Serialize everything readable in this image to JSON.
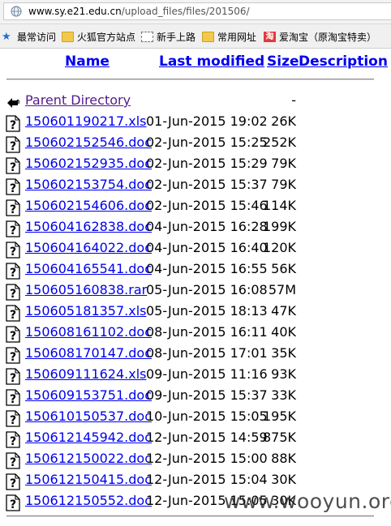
{
  "browser": {
    "url_host": "www.sy.e21.edu.cn",
    "url_path": "/upload_files/files/201506/"
  },
  "bookmarks": [
    {
      "label": "最常访问",
      "icon": "star-icon"
    },
    {
      "label": "火狐官方站点",
      "icon": "folder-icon"
    },
    {
      "label": "新手上路",
      "icon": "page-icon"
    },
    {
      "label": "常用网址",
      "icon": "folder-icon"
    },
    {
      "label": "爱淘宝（原淘宝特卖）",
      "icon": "taobao-icon"
    }
  ],
  "listing": {
    "headers": {
      "name": "Name",
      "modified": "Last modified",
      "size": "Size",
      "description": "Description"
    },
    "parent": {
      "label": "Parent Directory",
      "size": "-"
    },
    "files": [
      {
        "name": "150601190217.xls",
        "modified": "01-Jun-2015 19:02",
        "size": "26K"
      },
      {
        "name": "150602152546.doc",
        "modified": "02-Jun-2015 15:25",
        "size": "252K"
      },
      {
        "name": "150602152935.doc",
        "modified": "02-Jun-2015 15:29",
        "size": "79K"
      },
      {
        "name": "150602153754.doc",
        "modified": "02-Jun-2015 15:37",
        "size": "79K"
      },
      {
        "name": "150602154606.doc",
        "modified": "02-Jun-2015 15:46",
        "size": "114K"
      },
      {
        "name": "150604162838.doc",
        "modified": "04-Jun-2015 16:28",
        "size": "199K"
      },
      {
        "name": "150604164022.doc",
        "modified": "04-Jun-2015 16:40",
        "size": "120K"
      },
      {
        "name": "150604165541.doc",
        "modified": "04-Jun-2015 16:55",
        "size": "56K"
      },
      {
        "name": "150605160838.rar",
        "modified": "05-Jun-2015 16:08",
        "size": "57M"
      },
      {
        "name": "150605181357.xls",
        "modified": "05-Jun-2015 18:13",
        "size": "47K"
      },
      {
        "name": "150608161102.doc",
        "modified": "08-Jun-2015 16:11",
        "size": "40K"
      },
      {
        "name": "150608170147.doc",
        "modified": "08-Jun-2015 17:01",
        "size": "35K"
      },
      {
        "name": "150609111624.xls",
        "modified": "09-Jun-2015 11:16",
        "size": "93K"
      },
      {
        "name": "150609153751.doc",
        "modified": "09-Jun-2015 15:37",
        "size": "33K"
      },
      {
        "name": "150610150537.doc",
        "modified": "10-Jun-2015 15:05",
        "size": "195K"
      },
      {
        "name": "150612145942.doc",
        "modified": "12-Jun-2015 14:59",
        "size": "875K"
      },
      {
        "name": "150612150022.doc",
        "modified": "12-Jun-2015 15:00",
        "size": "88K"
      },
      {
        "name": "150612150415.doc",
        "modified": "12-Jun-2015 15:04",
        "size": "30K"
      },
      {
        "name": "150612150552.doc",
        "modified": "12-Jun-2015 15:05",
        "size": "30K"
      }
    ]
  },
  "watermark": "www.wooyun.org"
}
